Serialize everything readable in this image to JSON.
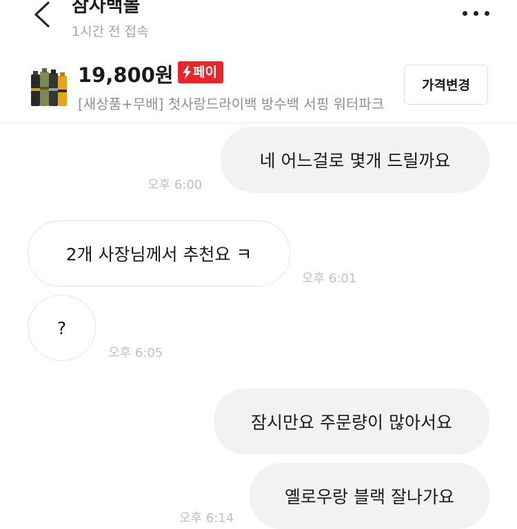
{
  "header": {
    "title": "잠자백볼",
    "status": "1시간 전 접속"
  },
  "product": {
    "price": "19,800원",
    "pay_badge": "페이",
    "title": "[새상품+무배] 첫사랑드라이백 방수백 서핑 워터파크",
    "price_change_button": "가격변경"
  },
  "messages": [
    {
      "side": "mine",
      "text": "네 어느걸로 몇개 드릴까요",
      "time": "오후 6:00"
    },
    {
      "side": "theirs",
      "text": "2개 사장님께서  추천요 ㅋ",
      "time": "오후 6:01"
    },
    {
      "side": "theirs",
      "text": "?",
      "time": "오후 6:05"
    },
    {
      "side": "mine",
      "text": "잠시만요 주문량이 많아서요",
      "time": ""
    },
    {
      "side": "mine",
      "text": "옐로우랑 블랙 잘나가요",
      "time": "오후 6:14"
    }
  ],
  "colors": {
    "pay_badge": "#e6262b",
    "my_bubble": "#f2f2f2",
    "their_bubble_border": "#e3e3e3",
    "time_text": "#c0c0c0"
  },
  "icons": {
    "back": "chevron-left-icon",
    "more": "more-horizontal-icon",
    "pay": "lightning-icon"
  }
}
